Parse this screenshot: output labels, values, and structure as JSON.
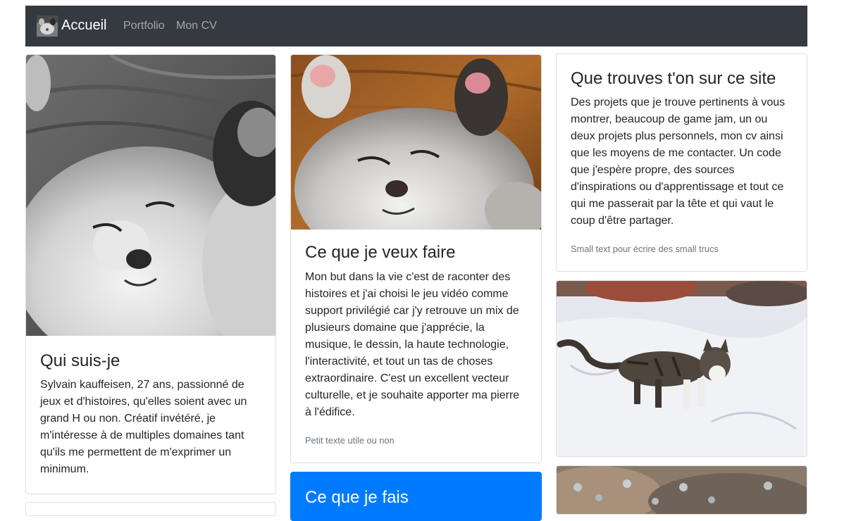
{
  "navbar": {
    "brand": "Accueil",
    "links": [
      "Portfolio",
      "Mon CV"
    ]
  },
  "cards": {
    "qui": {
      "title": "Qui suis-je",
      "text": "Sylvain kauffeisen, 27 ans, passionné de jeux et d'histoires, qu'elles soient avec un grand H ou non. Créatif invétéré, je m'intéresse à de multiples domaines tant qu'ils me permettent de m'exprimer un minimum."
    },
    "veux": {
      "title": "Ce que je veux faire",
      "text": "Mon but dans la vie c'est de raconter des histoires et j'ai choisi le jeu vidéo comme support privilégié car j'y retrouve un mix de plusieurs domaine que j'apprécie, la musique, le dessin, la haute technologie, l'interactivité, et tout un tas de choses extraordinaire. C'est un excellent vecteur culturelle, et je souhaite apporter ma pierre à l'édifice.",
      "small": "Petit texte utile ou non"
    },
    "site": {
      "title": "Que trouves t'on sur ce site",
      "text": "Des projets que je trouve pertinents à vous montrer, beaucoup de game jam, un ou deux projets plus personnels, mon cv ainsi que les moyens de me contacter. Un code que j'espère propre, des sources d'inspirations ou d'apprentissage et tout ce qui me passerait par la tête et qui vaut le coup d'être partager.",
      "small": "Small text pour écrire des small trucs"
    },
    "fais": {
      "title": "Ce que je fais"
    }
  },
  "colors": {
    "navbar_bg": "#343a40",
    "primary": "#007bff",
    "muted": "#6c757d"
  },
  "icons": {
    "brand_logo": "kitten-thumbnail"
  }
}
